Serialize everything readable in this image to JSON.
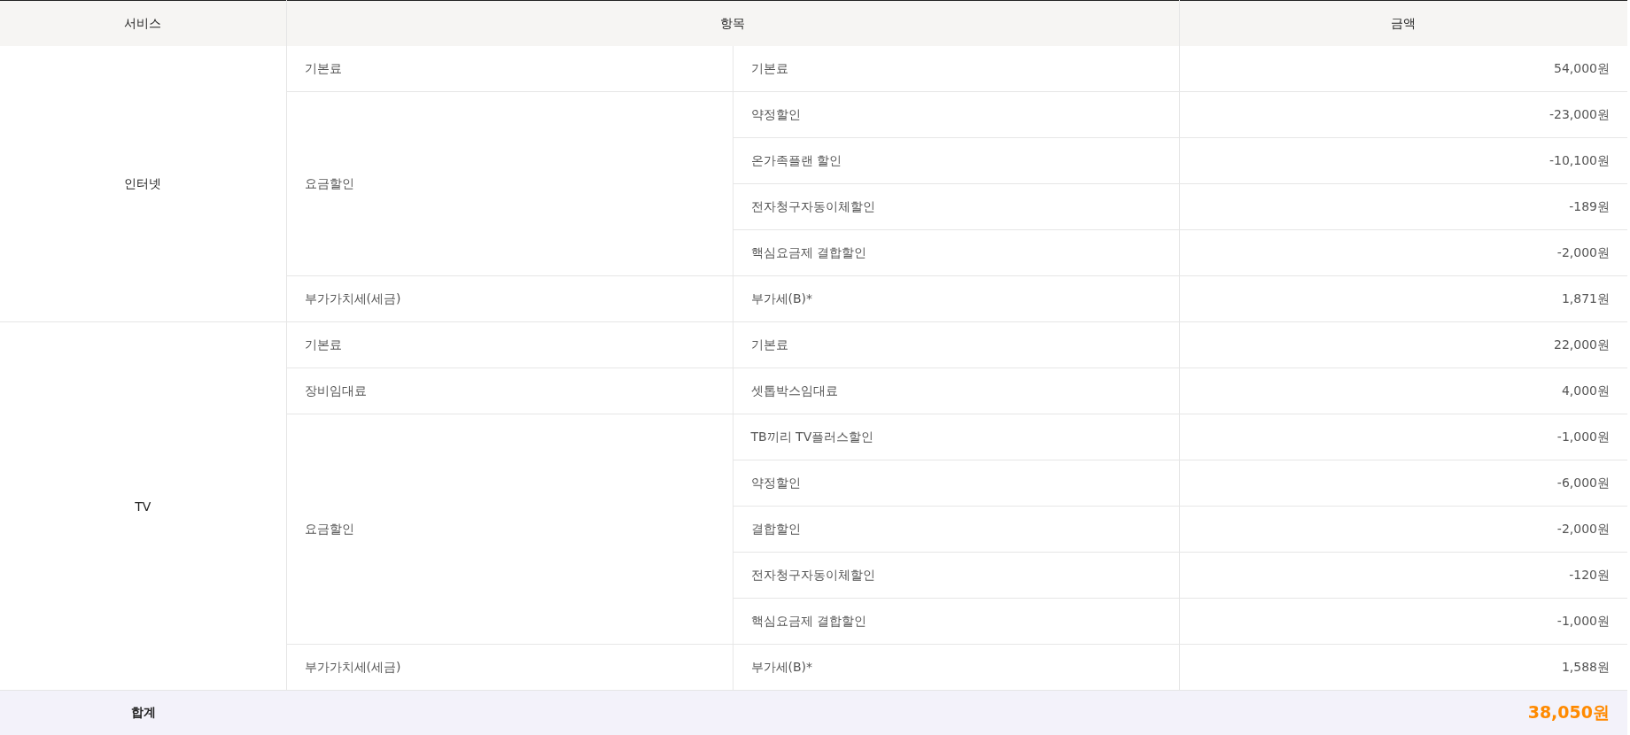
{
  "columns": [
    "서비스",
    "항목",
    "금액"
  ],
  "services": [
    {
      "name": "인터넷",
      "groups": [
        {
          "name": "기본료",
          "items": [
            {
              "name": "기본료",
              "amount": "54,000원"
            }
          ]
        },
        {
          "name": "요금할인",
          "items": [
            {
              "name": "약정할인",
              "amount": "-23,000원"
            },
            {
              "name": "온가족플랜 할인",
              "amount": "-10,100원"
            },
            {
              "name": "전자청구자동이체할인",
              "amount": "-189원"
            },
            {
              "name": "핵심요금제 결합할인",
              "amount": "-2,000원"
            }
          ]
        },
        {
          "name": "부가가치세(세금)",
          "items": [
            {
              "name": "부가세(B)*",
              "amount": "1,871원"
            }
          ]
        }
      ]
    },
    {
      "name": "TV",
      "groups": [
        {
          "name": "기본료",
          "items": [
            {
              "name": "기본료",
              "amount": "22,000원"
            }
          ]
        },
        {
          "name": "장비임대료",
          "items": [
            {
              "name": "셋톱박스임대료",
              "amount": "4,000원"
            }
          ]
        },
        {
          "name": "요금할인",
          "items": [
            {
              "name": "TB끼리 TV플러스할인",
              "amount": "-1,000원"
            },
            {
              "name": "약정할인",
              "amount": "-6,000원"
            },
            {
              "name": "결합할인",
              "amount": "-2,000원"
            },
            {
              "name": "전자청구자동이체할인",
              "amount": "-120원"
            },
            {
              "name": "핵심요금제 결합할인",
              "amount": "-1,000원"
            }
          ]
        },
        {
          "name": "부가가치세(세금)",
          "items": [
            {
              "name": "부가세(B)*",
              "amount": "1,588원"
            }
          ]
        }
      ]
    }
  ],
  "total": {
    "label": "합계",
    "amount": "38,050원"
  }
}
